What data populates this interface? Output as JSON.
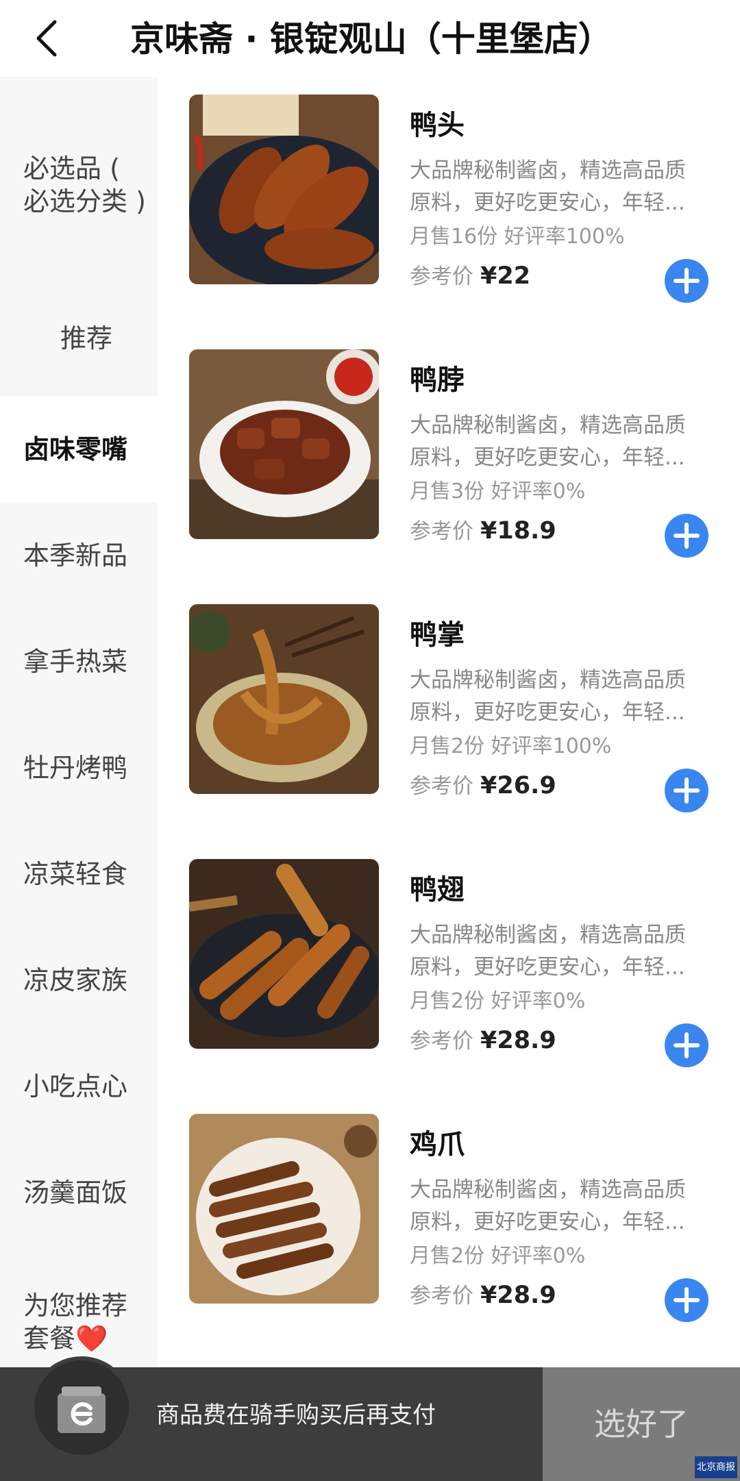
{
  "header": {
    "title": "京味斋 · 银锭观山（十里堡店）"
  },
  "sidebar": {
    "items": [
      {
        "label": "必选品 ( 必选分类 )",
        "active": false
      },
      {
        "label": "推荐",
        "active": false
      },
      {
        "label": "卤味零嘴",
        "active": true
      },
      {
        "label": "本季新品",
        "active": false
      },
      {
        "label": "拿手热菜",
        "active": false
      },
      {
        "label": "牡丹烤鸭",
        "active": false
      },
      {
        "label": "凉菜轻食",
        "active": false
      },
      {
        "label": "凉皮家族",
        "active": false
      },
      {
        "label": "小吃点心",
        "active": false
      },
      {
        "label": "汤羹面饭",
        "active": false
      },
      {
        "label": "为您推荐套餐",
        "active": false,
        "suffix": "❤️"
      }
    ]
  },
  "products": [
    {
      "name": "鸭头",
      "desc_line1": "大品牌秘制酱卤，精选高品质",
      "desc_line2": "原料，更好吃更安心，年轻...",
      "sales": "月售16份 好评率100%",
      "price_label": "参考价",
      "price": "¥22"
    },
    {
      "name": "鸭脖",
      "desc_line1": "大品牌秘制酱卤，精选高品质",
      "desc_line2": "原料，更好吃更安心，年轻...",
      "sales": "月售3份 好评率0%",
      "price_label": "参考价",
      "price": "¥18.9"
    },
    {
      "name": "鸭掌",
      "desc_line1": "大品牌秘制酱卤，精选高品质",
      "desc_line2": "原料，更好吃更安心，年轻...",
      "sales": "月售2份 好评率100%",
      "price_label": "参考价",
      "price": "¥26.9"
    },
    {
      "name": "鸭翅",
      "desc_line1": "大品牌秘制酱卤，精选高品质",
      "desc_line2": "原料，更好吃更安心，年轻...",
      "sales": "月售2份 好评率0%",
      "price_label": "参考价",
      "price": "¥28.9"
    },
    {
      "name": "鸡爪",
      "desc_line1": "大品牌秘制酱卤，精选高品质",
      "desc_line2": "原料，更好吃更安心，年轻...",
      "sales": "月售2份 好评率0%",
      "price_label": "参考价",
      "price": "¥28.9"
    }
  ],
  "bottom_bar": {
    "payment_note": "商品费在骑手购买后再支付",
    "confirm_label": "选好了"
  },
  "watermark": "北京商报",
  "colors": {
    "accent": "#3a86f0",
    "sidebar_bg": "#f7f7f7",
    "bottom_bar_bg": "#3d3d3d",
    "confirm_bg": "#7b7b7b"
  }
}
